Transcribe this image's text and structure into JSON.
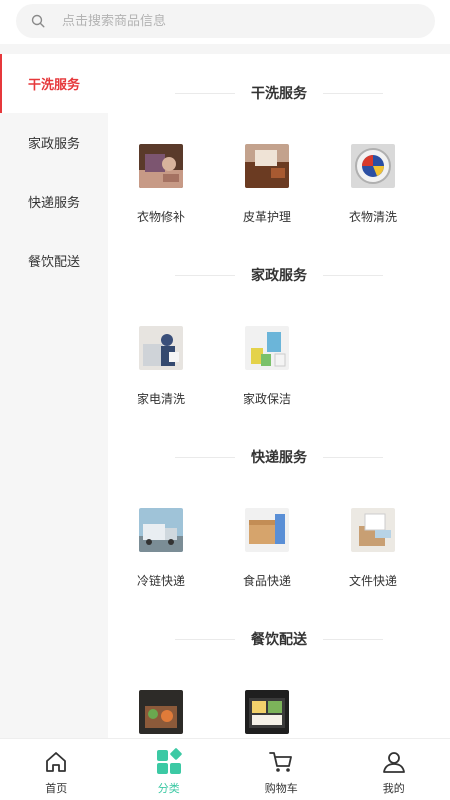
{
  "search": {
    "placeholder": "点击搜索商品信息"
  },
  "sidebar": {
    "items": [
      {
        "label": "干洗服务",
        "active": true
      },
      {
        "label": "家政服务",
        "active": false
      },
      {
        "label": "快递服务",
        "active": false
      },
      {
        "label": "餐饮配送",
        "active": false
      }
    ]
  },
  "sections": [
    {
      "title": "干洗服务",
      "items": [
        {
          "label": "衣物修补"
        },
        {
          "label": "皮革护理"
        },
        {
          "label": "衣物清洗"
        }
      ]
    },
    {
      "title": "家政服务",
      "items": [
        {
          "label": "家电清洗"
        },
        {
          "label": "家政保洁"
        }
      ]
    },
    {
      "title": "快递服务",
      "items": [
        {
          "label": "冷链快递"
        },
        {
          "label": "食品快递"
        },
        {
          "label": "文件快递"
        }
      ]
    },
    {
      "title": "餐饮配送",
      "items": [
        {
          "label": ""
        },
        {
          "label": ""
        }
      ]
    }
  ],
  "tabbar": {
    "items": [
      {
        "label": "首页",
        "icon": "home-icon"
      },
      {
        "label": "分类",
        "icon": "category-icon",
        "active": true
      },
      {
        "label": "购物车",
        "icon": "cart-icon"
      },
      {
        "label": "我的",
        "icon": "user-icon"
      }
    ]
  },
  "colors": {
    "accent_red": "#e6383b",
    "accent_green": "#3cc9a4",
    "sidebar_bg": "#f6f6f6"
  }
}
